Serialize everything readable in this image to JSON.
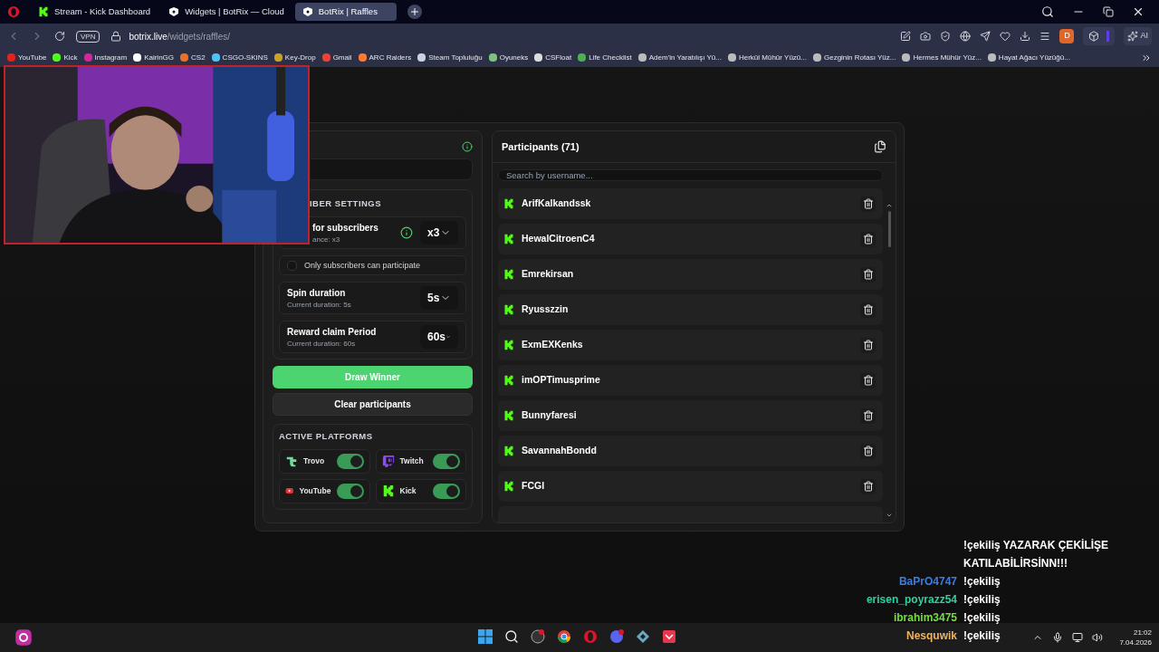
{
  "browser": {
    "tabs": [
      {
        "title": "Stream - Kick Dashboard",
        "selected": false
      },
      {
        "title": "Widgets | BotRix — Cloud",
        "selected": false
      },
      {
        "title": "BotRix | Raffles",
        "selected": true
      }
    ],
    "vpn_label": "VPN",
    "address": {
      "domain": "botrix.live",
      "path": "/widgets/raffles/"
    },
    "profile_initial": "D",
    "ai_label": "AI",
    "bookmarks": [
      {
        "label": "YouTube",
        "color": "#e62117"
      },
      {
        "label": "Kick",
        "color": "#53fc18"
      },
      {
        "label": "Instagram",
        "color": "#d6249f"
      },
      {
        "label": "KairinGG",
        "color": "#ffffff"
      },
      {
        "label": "CS2",
        "color": "#e8702a"
      },
      {
        "label": "CSGO-SKINS",
        "color": "#4fc3f7"
      },
      {
        "label": "Key-Drop",
        "color": "#c9a227"
      },
      {
        "label": "Gmail",
        "color": "#ea4335"
      },
      {
        "label": "ARC Raiders",
        "color": "#ff7a2f"
      },
      {
        "label": "Steam Topluluğu",
        "color": "#c7d5e0"
      },
      {
        "label": "Oyuneks",
        "color": "#7cc47c"
      },
      {
        "label": "CSFloat",
        "color": "#dddddd"
      },
      {
        "label": "Life Checklist",
        "color": "#4caf50"
      },
      {
        "label": "Adem'in Yaratılışı Yü...",
        "color": "#bbbbbb"
      },
      {
        "label": "Herkül Mühür Yüzü...",
        "color": "#bbbbbb"
      },
      {
        "label": "Gezginin Rotası Yüz...",
        "color": "#bbbbbb"
      },
      {
        "label": "Hermes Mühür Yüz...",
        "color": "#bbbbbb"
      },
      {
        "label": "Hayat Ağacı Yüzüğü...",
        "color": "#bbbbbb"
      }
    ]
  },
  "raffle": {
    "settings_heading": "IBER SETTINGS",
    "multiplier": {
      "label": "for subscribers",
      "sub": "ance: x3",
      "value": "x3"
    },
    "subscribers_only": {
      "label": "Only subscribers can participate",
      "checked": false
    },
    "spin": {
      "label": "Spin duration",
      "sub": "Current duration: 5s",
      "value": "5s"
    },
    "reward": {
      "label": "Reward claim Period",
      "sub": "Current duration: 60s",
      "value": "60s"
    },
    "draw_button": "Draw Winner",
    "clear_button": "Clear participants",
    "platforms_heading": "ACTIVE PLATFORMS",
    "platforms": [
      {
        "name": "Trovo",
        "kind": "trovo",
        "on": true
      },
      {
        "name": "Twitch",
        "kind": "twitch",
        "on": true
      },
      {
        "name": "YouTube",
        "kind": "youtube",
        "on": true
      },
      {
        "name": "Kick",
        "kind": "kick",
        "on": true
      }
    ]
  },
  "participants": {
    "title": "Participants (71)",
    "search_placeholder": "Search by username...",
    "items": [
      "ArifKalkandssk",
      "HewalCitroenC4",
      "Emrekirsan",
      "Ryusszzin",
      "ExmEXKenks",
      "imOPTimusprime",
      "Bunnyfaresi",
      "SavannahBondd",
      "FCGI"
    ]
  },
  "chat": [
    {
      "text": "!çekiliş YAZARAK ÇEKİLİŞE KATILABİLİRSİNN!!!"
    },
    {
      "user": "BaPrO4747",
      "color": "#3b7de0",
      "text": "!çekiliş"
    },
    {
      "user": "erisen_poyrazz54",
      "color": "#2fd0a0",
      "text": "!çekiliş"
    },
    {
      "user": "ibrahim3475",
      "color": "#6fe03a",
      "text": "!çekiliş"
    },
    {
      "user": "Nesquwik",
      "color": "#f2b35a",
      "text": "!çekiliş"
    }
  ],
  "tray": {
    "time": "21:02",
    "date": "7.04.2026"
  }
}
